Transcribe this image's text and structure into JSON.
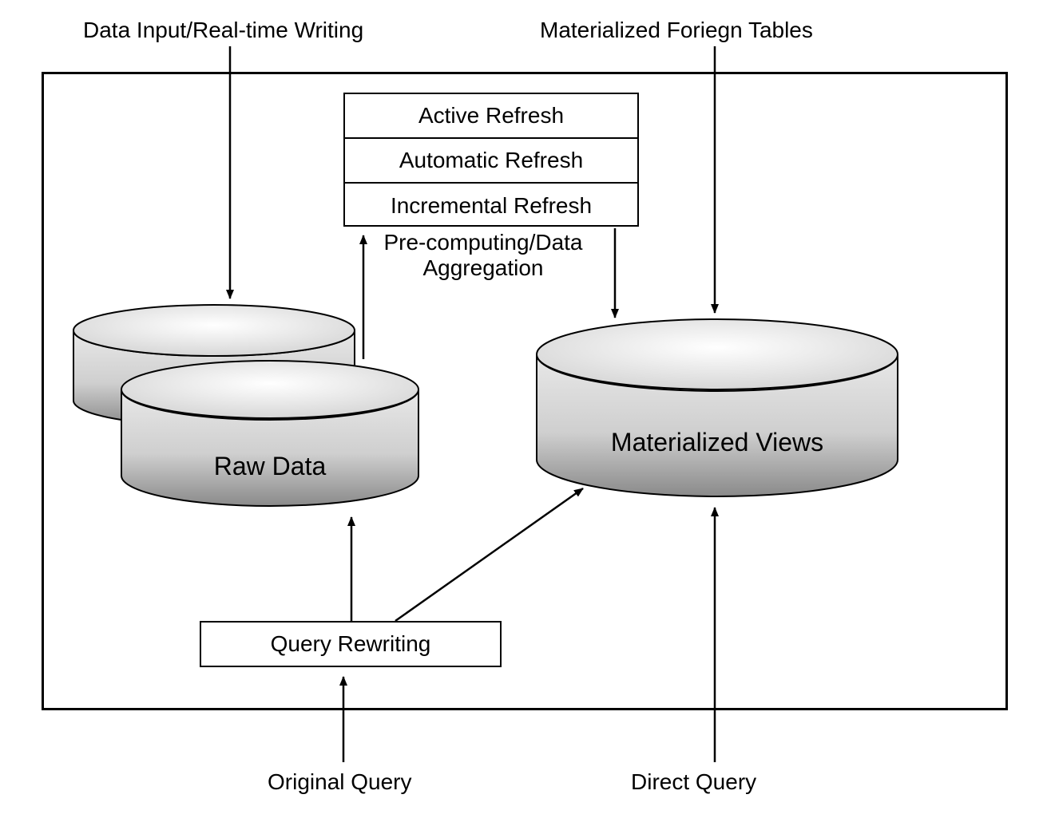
{
  "labels": {
    "top_left": "Data Input/Real-time Writing",
    "top_right": "Materialized Foriegn Tables",
    "bottom_center": "Original Query",
    "bottom_right": "Direct Query",
    "precomputing_line1": "Pre-computing/Data",
    "precomputing_line2": "Aggregation"
  },
  "refresh": {
    "row1": "Active Refresh",
    "row2": "Automatic Refresh",
    "row3": "Incremental Refresh"
  },
  "cylinders": {
    "raw_data": "Raw Data",
    "materialized_views": "Materialized Views"
  },
  "query_rewriting": "Query Rewriting"
}
